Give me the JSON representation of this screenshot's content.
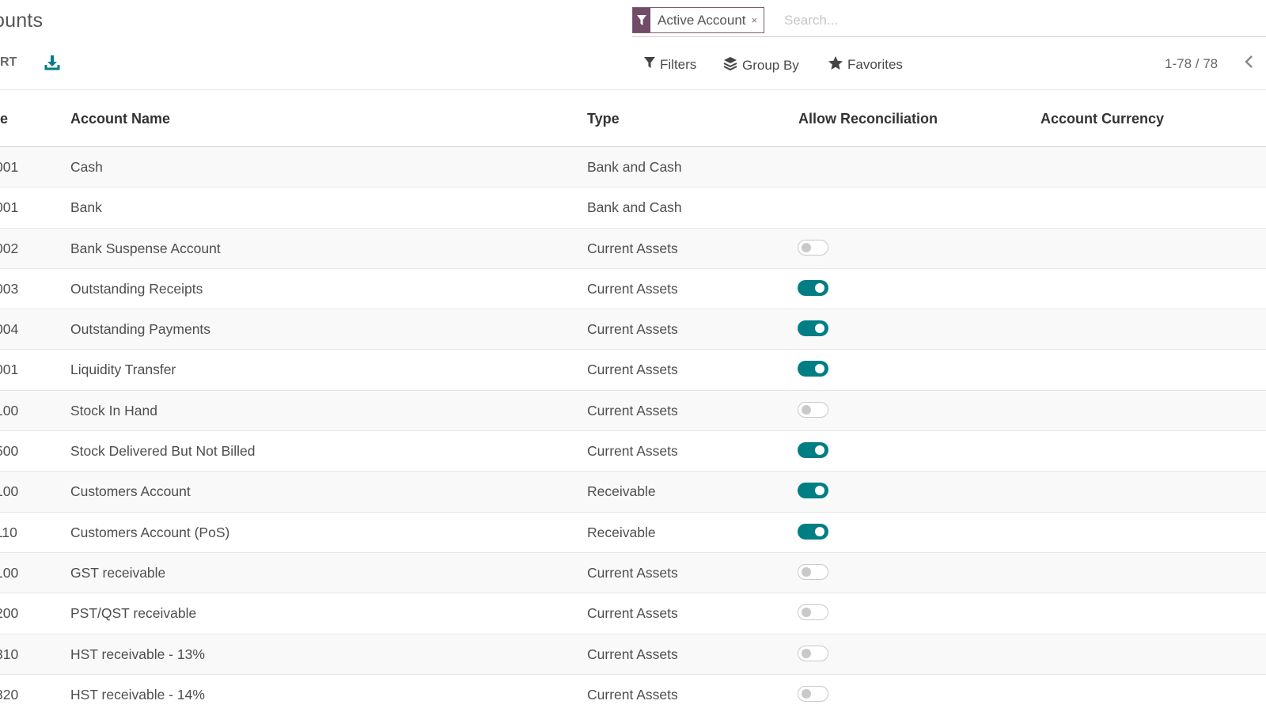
{
  "page": {
    "title": "ounts",
    "export_label": "RT"
  },
  "search": {
    "facet_label": "Active Account",
    "facet_close": "×",
    "placeholder": "Search..."
  },
  "controls": {
    "filters_label": "Filters",
    "groupby_label": "Group By",
    "favorites_label": "Favorites",
    "pager": "1-78 / 78"
  },
  "colors": {
    "brand": "#714b67",
    "toggle_on": "#017e84"
  },
  "icons": [
    "filter-icon",
    "download-icon",
    "layers-icon",
    "star-icon",
    "chevron-left-icon",
    "close-icon"
  ],
  "table": {
    "columns": [
      "e",
      "Account Name",
      "Type",
      "Allow Reconciliation",
      "Account Currency"
    ],
    "rows": [
      {
        "code": "001",
        "name": "Cash",
        "type": "Bank and Cash",
        "reconcile": null,
        "currency": ""
      },
      {
        "code": "001",
        "name": "Bank",
        "type": "Bank and Cash",
        "reconcile": null,
        "currency": ""
      },
      {
        "code": "002",
        "name": "Bank Suspense Account",
        "type": "Current Assets",
        "reconcile": false,
        "currency": ""
      },
      {
        "code": "003",
        "name": "Outstanding Receipts",
        "type": "Current Assets",
        "reconcile": true,
        "currency": ""
      },
      {
        "code": "004",
        "name": "Outstanding Payments",
        "type": "Current Assets",
        "reconcile": true,
        "currency": ""
      },
      {
        "code": "001",
        "name": "Liquidity Transfer",
        "type": "Current Assets",
        "reconcile": true,
        "currency": ""
      },
      {
        "code": "100",
        "name": "Stock In Hand",
        "type": "Current Assets",
        "reconcile": false,
        "currency": ""
      },
      {
        "code": "500",
        "name": "Stock Delivered But Not Billed",
        "type": "Current Assets",
        "reconcile": true,
        "currency": ""
      },
      {
        "code": "100",
        "name": "Customers Account",
        "type": "Receivable",
        "reconcile": true,
        "currency": ""
      },
      {
        "code": "110",
        "name": "Customers Account (PoS)",
        "type": "Receivable",
        "reconcile": true,
        "currency": ""
      },
      {
        "code": "100",
        "name": "GST receivable",
        "type": "Current Assets",
        "reconcile": false,
        "currency": ""
      },
      {
        "code": "200",
        "name": "PST/QST receivable",
        "type": "Current Assets",
        "reconcile": false,
        "currency": ""
      },
      {
        "code": "310",
        "name": "HST receivable - 13%",
        "type": "Current Assets",
        "reconcile": false,
        "currency": ""
      },
      {
        "code": "320",
        "name": "HST receivable - 14%",
        "type": "Current Assets",
        "reconcile": false,
        "currency": ""
      }
    ]
  }
}
